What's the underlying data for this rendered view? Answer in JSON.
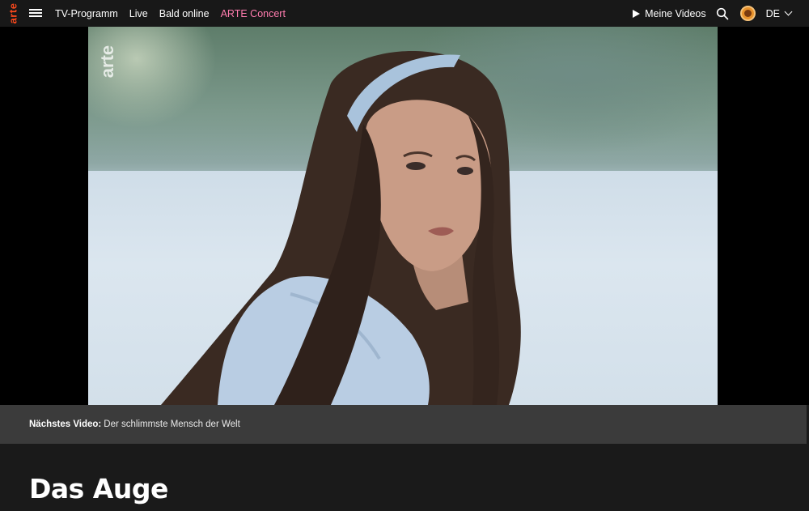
{
  "header": {
    "logo_text": "arte",
    "nav": [
      {
        "label": "TV-Programm"
      },
      {
        "label": "Live"
      },
      {
        "label": "Bald online"
      },
      {
        "label": "ARTE Concert"
      }
    ],
    "my_videos_label": "Meine Videos",
    "language": "DE",
    "accent_colors": {
      "logo": "#fa481c",
      "concert": "#ff7cae"
    }
  },
  "player": {
    "watermark": "arte"
  },
  "next_video": {
    "prefix": "Nächstes Video:",
    "title": "Der schlimmste Mensch der Welt"
  },
  "page": {
    "title": "Das Auge"
  },
  "icons": [
    "menu-icon",
    "play-icon",
    "search-icon",
    "avatar",
    "chevron-down-icon"
  ]
}
